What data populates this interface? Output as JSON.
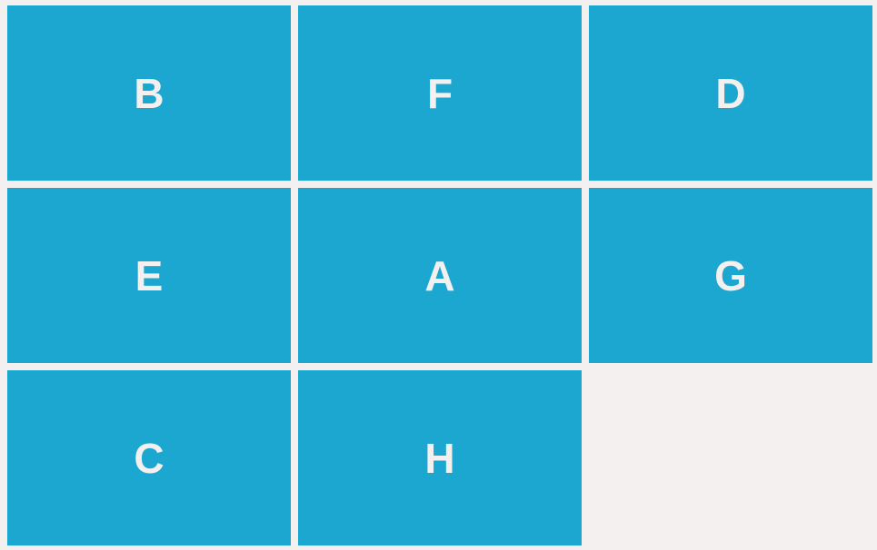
{
  "puzzle": {
    "tile_color": "#1ba7cf",
    "label_color": "#f4f0f0",
    "background_color": "#f4f0f0",
    "tiles": [
      {
        "label": "B"
      },
      {
        "label": "F"
      },
      {
        "label": "D"
      },
      {
        "label": "E"
      },
      {
        "label": "A"
      },
      {
        "label": "G"
      },
      {
        "label": "C"
      },
      {
        "label": "H"
      },
      {
        "label": ""
      }
    ]
  }
}
